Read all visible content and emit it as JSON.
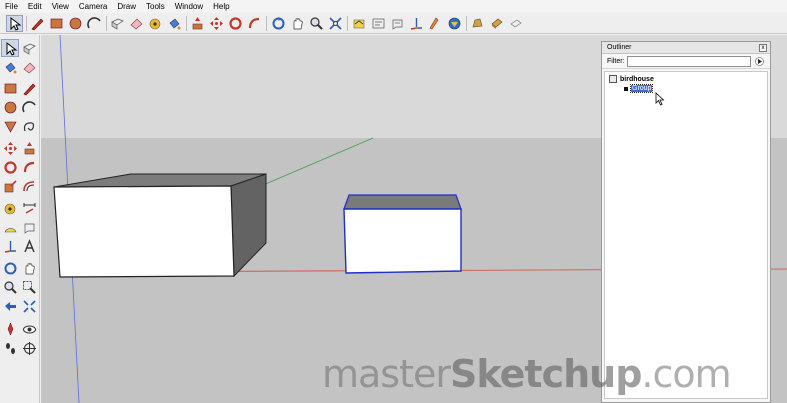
{
  "menu": [
    "File",
    "Edit",
    "View",
    "Camera",
    "Draw",
    "Tools",
    "Window",
    "Help"
  ],
  "toolbar_icons": [
    "select-icon",
    "pencil-icon",
    "rectangle-icon",
    "circle-icon",
    "arc-icon",
    "eraser-icon",
    "tape-measure-icon",
    "paint-bucket-icon",
    "push-pull-icon",
    "move-icon",
    "rotate-icon",
    "follow-me-icon",
    "orbit-icon",
    "pan-icon",
    "zoom-icon",
    "zoom-extents-icon",
    "components-icon",
    "dimension-icon",
    "text-icon",
    "axes-icon",
    "section-plane-icon",
    "get-models-icon",
    "share-model-icon",
    "warehouse-icon"
  ],
  "outliner": {
    "title": "Outliner",
    "close": "x",
    "filter_label": "Filter:",
    "filter_value": "",
    "root": "birdhouse",
    "child": "Group"
  },
  "watermark": {
    "part1": "master",
    "part2": "Sketchup",
    "part3": ".com"
  },
  "colors": {
    "sky": "#d8d8d8",
    "ground": "#c2c2c2",
    "selection": "#1f2fc8",
    "red_axis": "#d24a3a",
    "green_axis": "#3fa04a",
    "blue_axis": "#5b6fd8"
  }
}
